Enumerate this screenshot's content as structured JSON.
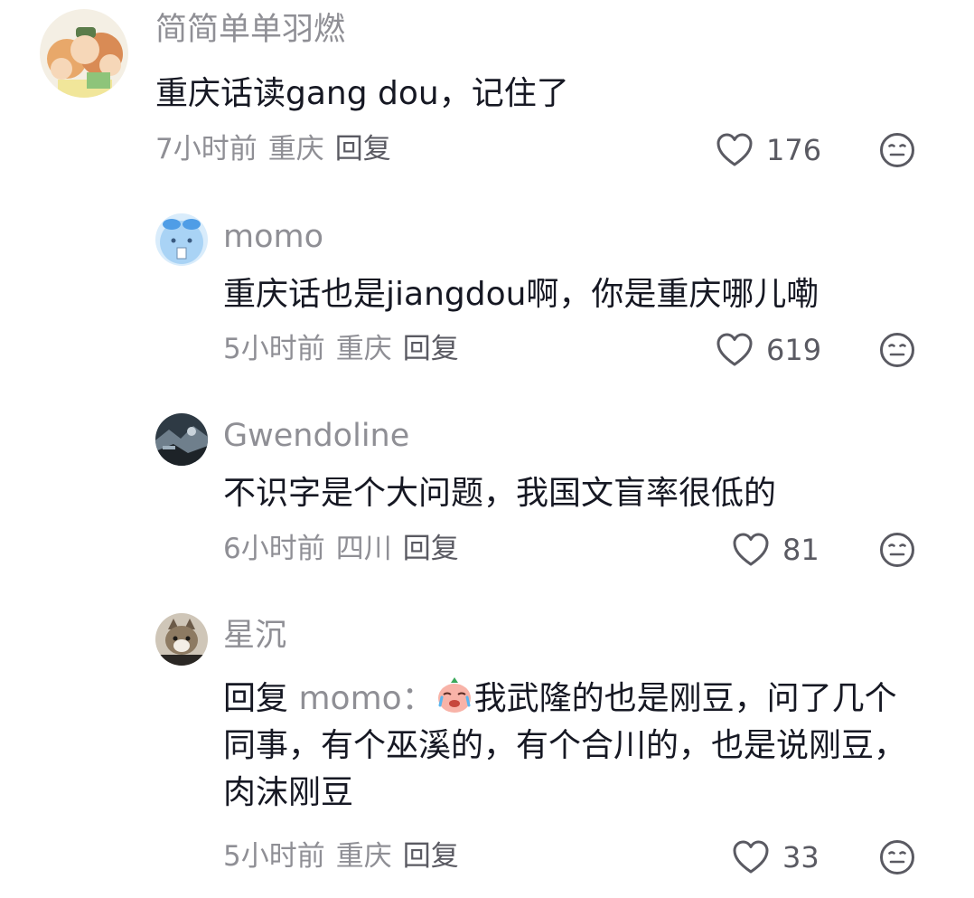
{
  "comments": [
    {
      "author": "简简单单羽燃",
      "text": "重庆话读gang dou，记住了",
      "time": "7小时前",
      "location": "重庆",
      "reply": "回复",
      "likes": "176"
    },
    {
      "author": "momo",
      "text": "重庆话也是jiangdou啊，你是重庆哪儿嘞",
      "time": "5小时前",
      "location": "重庆",
      "reply": "回复",
      "likes": "619"
    },
    {
      "author": "Gwendoline",
      "text": "不识字是个大问题，我国文盲率很低的",
      "time": "6小时前",
      "location": "四川",
      "reply": "回复",
      "likes": "81"
    },
    {
      "author": "星沉",
      "reply_prefix": "回复",
      "mention": "momo：",
      "text": "我武隆的也是刚豆，问了几个同事，有个巫溪的，有个合川的，也是说刚豆，肉沫刚豆",
      "time": "5小时前",
      "location": "重庆",
      "reply": "回复",
      "likes": "33"
    }
  ],
  "icons": {
    "like": "heart-outline-icon",
    "dislike": "meh-face-icon",
    "emoji": "crying-peach-emoji"
  },
  "colors": {
    "name": "#8f8f95",
    "text": "#161823",
    "meta": "#8f8f95"
  }
}
